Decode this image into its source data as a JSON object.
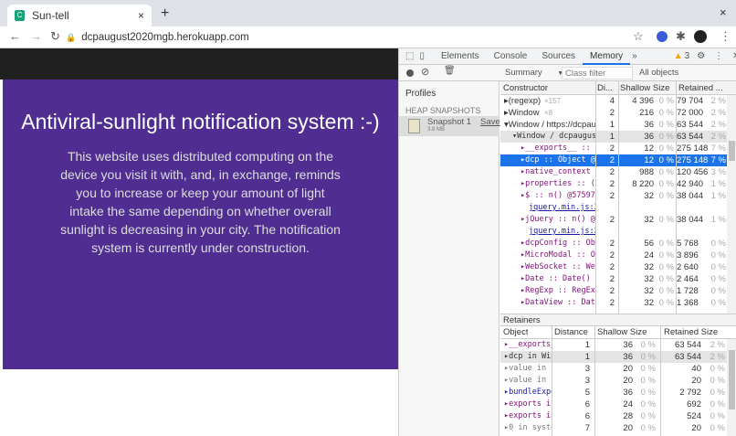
{
  "browser": {
    "tab_title": "Sun-tell",
    "url": "dcpaugust2020mgb.herokuapp.com"
  },
  "page": {
    "title": "Antiviral-sunlight notification system :-)",
    "body": "This website uses distributed computing on the device you visit it with, and, in exchange, reminds you to increase or keep your amount of light intake the same depending on whether overall sunlight is decreasing in your city. The notification system is currently under construction."
  },
  "devtools": {
    "tabs": [
      "Elements",
      "Console",
      "Sources",
      "Memory"
    ],
    "more": "»",
    "warnings": "3",
    "view": "Summary",
    "class_filter_placeholder": "Class filter",
    "filter_scope": "All objects",
    "profiles_label": "Profiles",
    "heap_label": "HEAP SNAPSHOTS",
    "snapshot": {
      "name": "Snapshot 1",
      "size": "3.8 MB",
      "save": "Save"
    },
    "columns": [
      "Constructor",
      "Di...",
      "Shallow Size",
      "Retained ..."
    ],
    "rows": [
      {
        "name": "▸(regexp)",
        "count": "×157",
        "d": "4",
        "s": "4 396",
        "sp": "0 %",
        "r": "79 704",
        "rp": "2 %",
        "indent": 0
      },
      {
        "name": "▸Window",
        "count": "×8",
        "d": "2",
        "s": "216",
        "sp": "0 %",
        "r": "72 000",
        "rp": "2 %",
        "indent": 0
      },
      {
        "name": "▾Window / https://dcpau...",
        "count": "",
        "d": "1",
        "s": "36",
        "sp": "0 %",
        "r": "63 544",
        "rp": "2 %",
        "indent": 0
      },
      {
        "name": "▾Window / dcpaugust20",
        "count": "",
        "d": "1",
        "s": "36",
        "sp": "0 %",
        "r": "63 544",
        "rp": "2 %",
        "indent": 1,
        "mono": true,
        "hl": true
      },
      {
        "name": "▸__exports__ :: Obj",
        "count": "",
        "d": "2",
        "s": "12",
        "sp": "0 %",
        "r": "275 148",
        "rp": "7 %",
        "indent": 2,
        "mono": true
      },
      {
        "name": "▸dcp :: Object @573",
        "count": "",
        "d": "2",
        "s": "12",
        "sp": "0 %",
        "r": "275 148",
        "rp": "7 %",
        "indent": 2,
        "mono": true,
        "sel": true
      },
      {
        "name": "▸native_context ::",
        "count": "",
        "d": "2",
        "s": "988",
        "sp": "0 %",
        "r": "120 456",
        "rp": "3 %",
        "indent": 2,
        "mono": true
      },
      {
        "name": "▸properties :: (obj",
        "count": "",
        "d": "2",
        "s": "8 220",
        "sp": "0 %",
        "r": "42 940",
        "rp": "1 %",
        "indent": 2,
        "mono": true
      },
      {
        "name": "▸$ :: n() @57597 □",
        "count": "",
        "d": "2",
        "s": "32",
        "sp": "0 %",
        "r": "38 044",
        "rp": "1 %",
        "indent": 2,
        "mono": true
      },
      {
        "name": "jquery.min.js:2",
        "link": true,
        "indent": 3
      },
      {
        "name": "▸jQuery :: n() @575",
        "count": "",
        "d": "2",
        "s": "32",
        "sp": "0 %",
        "r": "38 044",
        "rp": "1 %",
        "indent": 2,
        "mono": true
      },
      {
        "name": "jquery.min.js:2",
        "link": true,
        "indent": 3
      },
      {
        "name": "▸dcpConfig :: Objec",
        "count": "",
        "d": "2",
        "s": "56",
        "sp": "0 %",
        "r": "5 768",
        "rp": "0 %",
        "indent": 2,
        "mono": true
      },
      {
        "name": "▸MicroModal :: Obje",
        "count": "",
        "d": "2",
        "s": "24",
        "sp": "0 %",
        "r": "3 896",
        "rp": "0 %",
        "indent": 2,
        "mono": true
      },
      {
        "name": "▸WebSocket :: WebSo",
        "count": "",
        "d": "2",
        "s": "32",
        "sp": "0 %",
        "r": "2 640",
        "rp": "0 %",
        "indent": 2,
        "mono": true
      },
      {
        "name": "▸Date :: Date() @57",
        "count": "",
        "d": "2",
        "s": "32",
        "sp": "0 %",
        "r": "2 464",
        "rp": "0 %",
        "indent": 2,
        "mono": true
      },
      {
        "name": "▸RegExp :: RegExp()",
        "count": "",
        "d": "2",
        "s": "32",
        "sp": "0 %",
        "r": "1 728",
        "rp": "0 %",
        "indent": 2,
        "mono": true
      },
      {
        "name": "▸DataView :: DataVi",
        "count": "",
        "d": "2",
        "s": "32",
        "sp": "0 %",
        "r": "1 368",
        "rp": "0 %",
        "indent": 2,
        "mono": true
      }
    ],
    "retainers_label": "Retainers",
    "ret_columns": [
      "Object",
      "Distance",
      "Shallow Size",
      "Retained Size"
    ],
    "retainers": [
      {
        "name": "▸__exports_",
        "d": "1",
        "s": "36",
        "sp": "0 %",
        "r": "63 544",
        "rp": "2 %"
      },
      {
        "name": "▸dcp in Winc",
        "d": "1",
        "s": "36",
        "sp": "0 %",
        "r": "63 544",
        "rp": "2 %",
        "hl": true
      },
      {
        "name": "▸value in sy",
        "d": "3",
        "s": "20",
        "sp": "0 %",
        "r": "40",
        "rp": "0 %"
      },
      {
        "name": "▸value in sy",
        "d": "3",
        "s": "20",
        "sp": "0 %",
        "r": "20",
        "rp": "0 %"
      },
      {
        "name": "▸bundleExpo",
        "d": "5",
        "s": "36",
        "sp": "0 %",
        "r": "2 792",
        "rp": "0 %"
      },
      {
        "name": "▸exports in",
        "d": "6",
        "s": "24",
        "sp": "0 %",
        "r": "692",
        "rp": "0 %"
      },
      {
        "name": "▸exports in",
        "d": "6",
        "s": "28",
        "sp": "0 %",
        "r": "524",
        "rp": "0 %"
      },
      {
        "name": "▸0 in systen",
        "d": "7",
        "s": "20",
        "sp": "0 %",
        "r": "20",
        "rp": "0 %"
      }
    ]
  }
}
